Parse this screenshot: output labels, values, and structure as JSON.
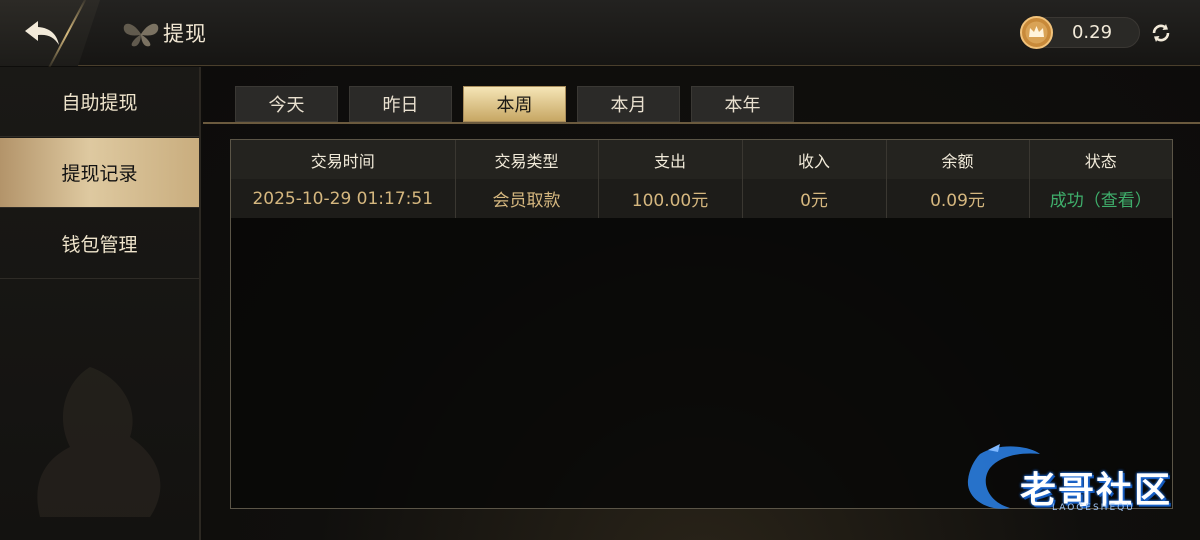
{
  "header": {
    "title": "提现",
    "balance": "0.29"
  },
  "sidebar": {
    "items": [
      {
        "label": "自助提现",
        "active": false
      },
      {
        "label": "提现记录",
        "active": true
      },
      {
        "label": "钱包管理",
        "active": false
      }
    ]
  },
  "tabs": [
    {
      "label": "今天",
      "active": false
    },
    {
      "label": "昨日",
      "active": false
    },
    {
      "label": "本周",
      "active": true
    },
    {
      "label": "本月",
      "active": false
    },
    {
      "label": "本年",
      "active": false
    }
  ],
  "table": {
    "columns": [
      "交易时间",
      "交易类型",
      "支出",
      "收入",
      "余额",
      "状态"
    ],
    "rows": [
      [
        "2025-10-29 01:17:51",
        "会员取款",
        "100.00元",
        "0元",
        "0.09元",
        "成功（查看）"
      ]
    ]
  },
  "watermark": {
    "text": "老哥社区",
    "subtext": "LAOGESHEQU"
  },
  "colors": {
    "accent_gold": "#d5b77f",
    "success_green": "#3fae6b",
    "active_tab": "#e3cc8f"
  },
  "icons": {
    "back": "back-arrow-icon",
    "coin": "crown-coin-icon",
    "refresh": "refresh-icon"
  }
}
